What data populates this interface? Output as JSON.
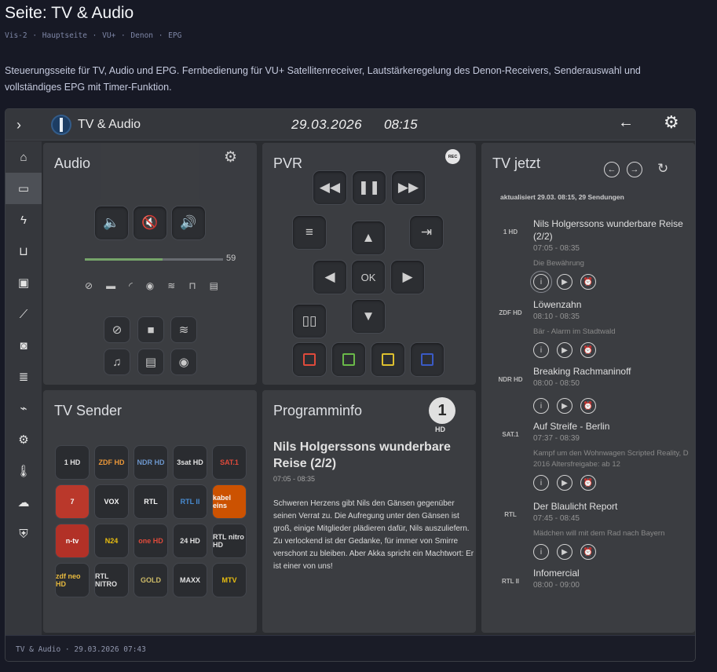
{
  "page": {
    "title": "Seite: TV & Audio",
    "breadcrumb": "Vis-2  ·  Hauptseite  ·  VU+ · Denon · EPG",
    "description": "Steuerungsseite für TV, Audio und EPG. Fernbedienung für VU+ Satellitenreceiver, Lautstärkeregelung des Denon-Receivers, Senderauswahl und vollständiges EPG mit Timer-Funktion."
  },
  "topbar": {
    "title": "TV & Audio",
    "date": "29.03.2026",
    "time": "08:15",
    "icons": [
      "chevron-right-icon",
      "back-arrow-icon",
      "gear-icon"
    ]
  },
  "sidebar": {
    "items": [
      {
        "icon": "home-icon",
        "glyph": "⌂"
      },
      {
        "icon": "cast-icon",
        "glyph": "▭",
        "active": true
      },
      {
        "icon": "lightning-icon",
        "glyph": "ϟ"
      },
      {
        "icon": "sofa-icon",
        "glyph": "⊔"
      },
      {
        "icon": "fridge-icon",
        "glyph": "▣"
      },
      {
        "icon": "chart-icon",
        "glyph": "⟋"
      },
      {
        "icon": "camera-icon",
        "glyph": "◙"
      },
      {
        "icon": "server-icon",
        "glyph": "≣"
      },
      {
        "icon": "router-icon",
        "glyph": "⌁"
      },
      {
        "icon": "settings-icon",
        "glyph": "⚙"
      },
      {
        "icon": "thermometer-icon",
        "glyph": "🌡"
      },
      {
        "icon": "weather-icon",
        "glyph": "☁"
      },
      {
        "icon": "shield-icon",
        "glyph": "⛨"
      }
    ]
  },
  "audio": {
    "title": "Audio",
    "volume": 59,
    "volume_label": "59",
    "volume_fraction": 0.56,
    "source_icons": [
      "tv-off-icon",
      "bus-icon",
      "cast-icon",
      "record-icon",
      "spotify-icon",
      "usb-icon",
      "radio-icon"
    ],
    "source_buttons": [
      {
        "icon": "tv-off-icon",
        "glyph": "⊘"
      },
      {
        "icon": "camera-icon",
        "glyph": "▶"
      },
      {
        "icon": "spotify-icon",
        "glyph": "≋"
      },
      {
        "icon": "media-icon",
        "glyph": "♫"
      },
      {
        "icon": "radio-icon",
        "glyph": "▤"
      },
      {
        "icon": "disc-icon",
        "glyph": "◉"
      }
    ]
  },
  "pvr": {
    "title": "PVR",
    "rec_badge": "REC",
    "ok_label": "OK"
  },
  "tv_now": {
    "title": "TV jetzt",
    "updated": "aktualisiert 29.03. 08:15, 29 Sendungen",
    "entries": [
      {
        "channel": "1 HD",
        "title": "Nils Holgerssons wunderbare Reise (2/2)",
        "time": "07:05 - 08:35",
        "subtitle": "Die Bewährung"
      },
      {
        "channel": "ZDF HD",
        "title": "Löwenzahn",
        "time": "08:10 - 08:35",
        "subtitle": "Bär - Alarm im Stadtwald"
      },
      {
        "channel": "NDR HD",
        "title": "Breaking Rachmaninoff",
        "time": "08:00 - 08:50",
        "subtitle": ""
      },
      {
        "channel": "SAT.1",
        "title": "Auf Streife - Berlin",
        "time": "07:37 - 08:39",
        "subtitle": "Kampf um den Wohnwagen Scripted Reality, D 2016 Altersfreigabe: ab 12"
      },
      {
        "channel": "RTL",
        "title": "Der Blaulicht Report",
        "time": "07:45 - 08:45",
        "subtitle": "Mädchen will mit dem Rad nach Bayern"
      },
      {
        "channel": "RTL II",
        "title": "Infomercial",
        "time": "08:00 - 09:00",
        "subtitle": ""
      }
    ]
  },
  "tv_sender": {
    "title": "TV Sender",
    "channels": [
      {
        "label": "1 HD",
        "color": "#e8e8e8",
        "bg": "#2b2d31"
      },
      {
        "label": "ZDF HD",
        "color": "#f39c3a",
        "bg": "#2b2d31"
      },
      {
        "label": "NDR HD",
        "color": "#6f9bd3",
        "bg": "#2b2d31"
      },
      {
        "label": "3sat HD",
        "color": "#e8e8e8",
        "bg": "#2b2d31"
      },
      {
        "label": "SAT.1",
        "color": "#e74c3c",
        "bg": "#2b2d31"
      },
      {
        "label": "7",
        "color": "#ffffff",
        "bg": "#c0392b"
      },
      {
        "label": "VOX",
        "color": "#ffffff",
        "bg": "#2b2d31"
      },
      {
        "label": "RTL",
        "color": "#ffffff",
        "bg": "#2b2d31"
      },
      {
        "label": "RTL II",
        "color": "#4a90d9",
        "bg": "#2b2d31"
      },
      {
        "label": "kabel eins",
        "color": "#ffffff",
        "bg": "#d35400"
      },
      {
        "label": "n-tv",
        "color": "#ffffff",
        "bg": "#b83227"
      },
      {
        "label": "N24",
        "color": "#f1c40f",
        "bg": "#2b2d31"
      },
      {
        "label": "one HD",
        "color": "#e74c3c",
        "bg": "#2b2d31"
      },
      {
        "label": "24 HD",
        "color": "#e8e8e8",
        "bg": "#2b2d31"
      },
      {
        "label": "RTL nitro HD",
        "color": "#e8e8e8",
        "bg": "#2b2d31"
      },
      {
        "label": "zdf neo HD",
        "color": "#f0c040",
        "bg": "#2b2d31"
      },
      {
        "label": "RTL NITRO",
        "color": "#e8e8e8",
        "bg": "#2b2d31"
      },
      {
        "label": "GOLD",
        "color": "#d4c06a",
        "bg": "#2b2d31"
      },
      {
        "label": "MAXX",
        "color": "#e8e8e8",
        "bg": "#2b2d31"
      },
      {
        "label": "MTV",
        "color": "#f1c40f",
        "bg": "#2b2d31"
      }
    ]
  },
  "programminfo": {
    "title": "Programminfo",
    "channel_logo": "1",
    "channel_hd": "HD",
    "show_title": "Nils Holgerssons wunderbare Reise (2/2)",
    "time": "07:05 - 08:35",
    "text": "Schweren Herzens gibt Nils den Gänsen gegenüber seinen Verrat zu. Die Aufregung unter den Gänsen ist groß, einige Mitglieder plädieren dafür, Nils auszuliefern. Zu verlockend ist der Gedanke, für immer von Smirre verschont zu bleiben. Aber Akka spricht ein Machtwort: Er ist einer von uns!"
  },
  "footer": {
    "text": "TV & Audio · 29.03.2026 07:43"
  },
  "colors": {
    "page_bg": "#171925",
    "frame_bg": "#2a2c30",
    "tile_bg": "#3c3e42",
    "volume_fill": "#7aa96d",
    "color_buttons": [
      "#e74c3c",
      "#6dbf4b",
      "#e6c72f",
      "#3b5ccc"
    ]
  }
}
